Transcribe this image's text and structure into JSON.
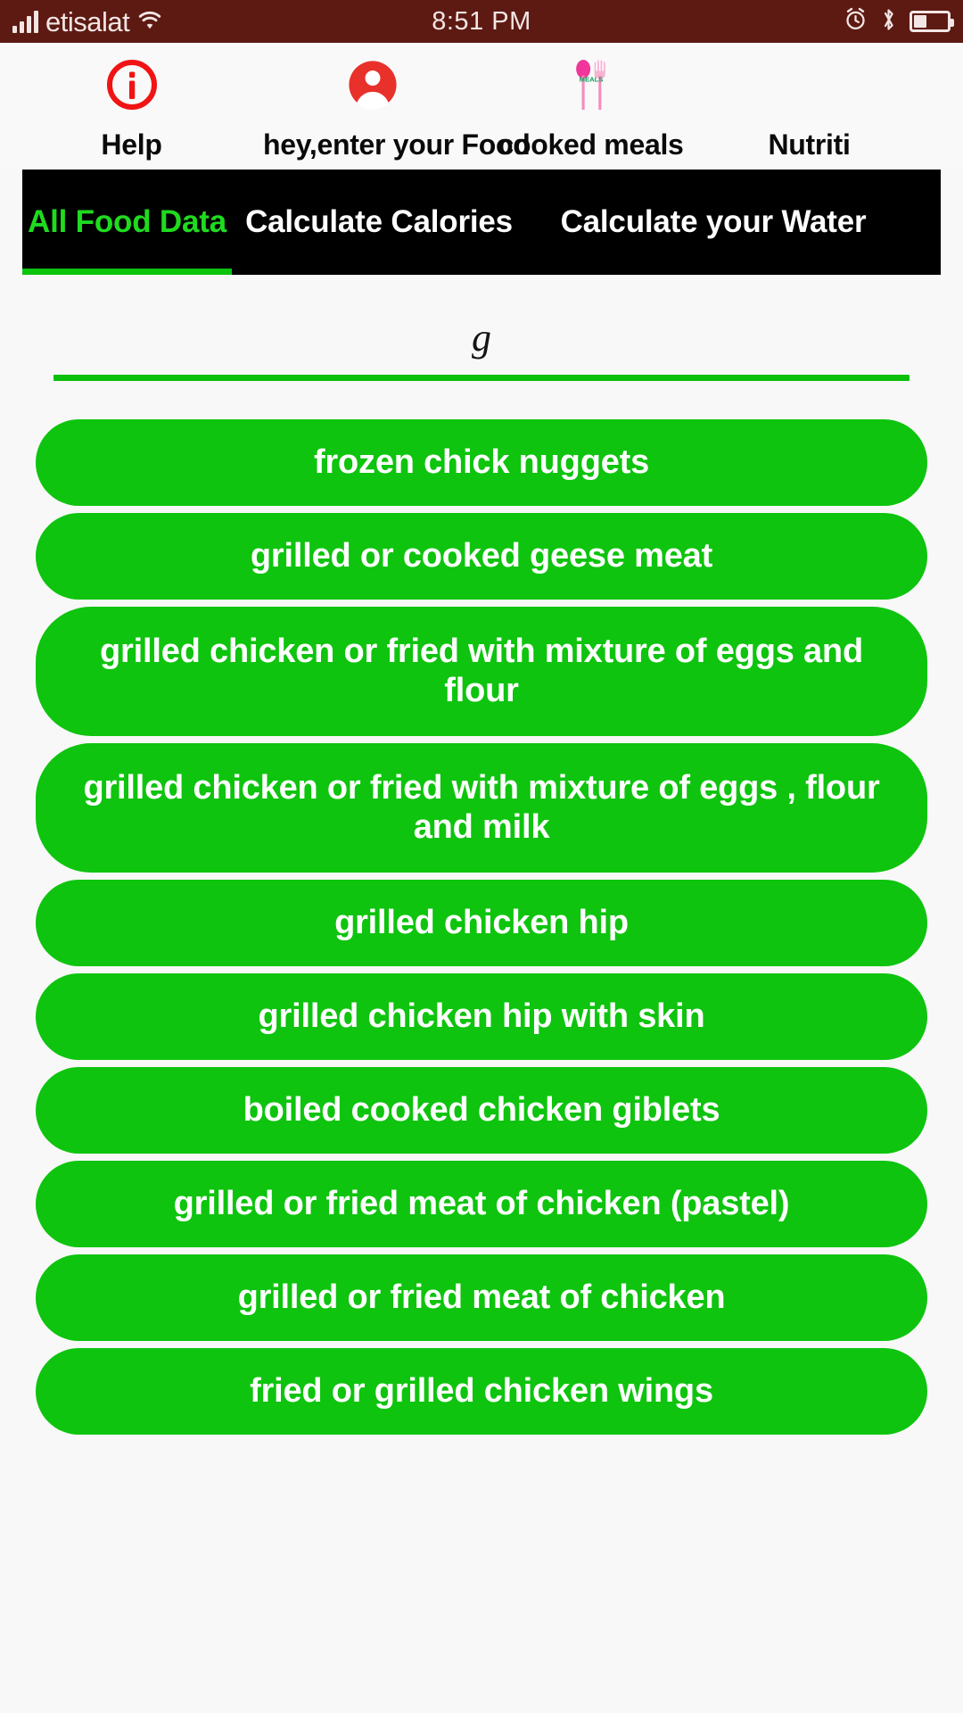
{
  "status_bar": {
    "carrier": "etisalat",
    "time": "8:51 PM",
    "signal_icon": "signal-bars-icon",
    "wifi_icon": "wifi-icon",
    "alarm_icon": "alarm-icon",
    "bluetooth_icon": "bluetooth-icon",
    "battery_icon": "battery-icon",
    "background_color": "#5d1a13",
    "foreground_color": "#f2e6e4"
  },
  "top_nav": {
    "items": [
      {
        "label": "Help",
        "icon": "info-circle-icon",
        "icon_color": "#f01414"
      },
      {
        "label": "hey,enter your Food",
        "icon": "account-circle-icon",
        "icon_color": "#e8312b"
      },
      {
        "label": "cooked meals",
        "icon": "meals-spoon-fork-icon",
        "icon_color": "#f0369b",
        "icon_text": "MEALS"
      },
      {
        "label": "Nutriti",
        "icon": "nutrition-icon",
        "icon_color": "#f01414"
      }
    ]
  },
  "tabs": {
    "background_color": "#000000",
    "active_color": "#1fdb1f",
    "inactive_color": "#ffffff",
    "active_index": 0,
    "items": [
      {
        "label": "All Food Data"
      },
      {
        "label": "Calculate Calories"
      },
      {
        "label": "Calculate your Water"
      }
    ]
  },
  "search": {
    "value": "g",
    "placeholder": "",
    "underline_color": "#0bbf0b"
  },
  "food_list": {
    "item_color": "#0ec40e",
    "text_color": "#ffffff",
    "items": [
      {
        "label": "frozen chick nuggets",
        "lines": 1
      },
      {
        "label": "grilled or cooked geese meat",
        "lines": 1
      },
      {
        "label": "grilled chicken or fried with mixture of eggs and flour",
        "lines": 2
      },
      {
        "label": "grilled chicken or fried with mixture of eggs , flour and milk",
        "lines": 2
      },
      {
        "label": "grilled chicken hip",
        "lines": 1
      },
      {
        "label": "grilled chicken hip with skin",
        "lines": 1
      },
      {
        "label": "boiled cooked chicken giblets",
        "lines": 1
      },
      {
        "label": "grilled or fried meat of chicken (pastel)",
        "lines": 1
      },
      {
        "label": "grilled or fried meat of chicken",
        "lines": 1
      },
      {
        "label": "fried or grilled chicken wings",
        "lines": 1
      }
    ]
  }
}
